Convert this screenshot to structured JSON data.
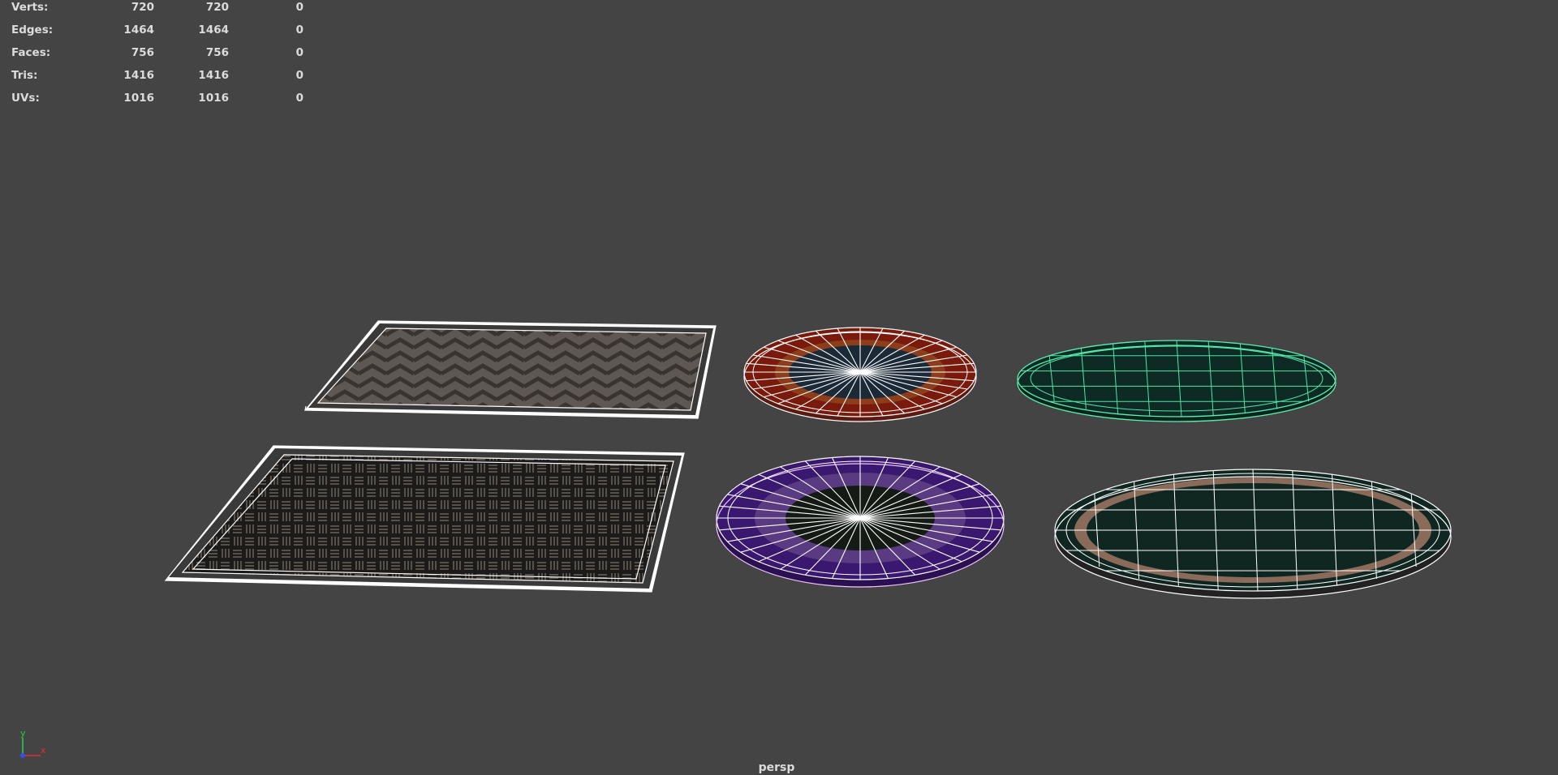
{
  "hud": {
    "rows": [
      {
        "label": "Verts:",
        "v1": "720",
        "v2": "720",
        "v3": "0"
      },
      {
        "label": "Edges:",
        "v1": "1464",
        "v2": "1464",
        "v3": "0"
      },
      {
        "label": "Faces:",
        "v1": "756",
        "v2": "756",
        "v3": "0"
      },
      {
        "label": "Tris:",
        "v1": "1416",
        "v2": "1416",
        "v3": "0"
      },
      {
        "label": "UVs:",
        "v1": "1016",
        "v2": "1016",
        "v3": "0"
      }
    ]
  },
  "viewport": {
    "camera": "persp",
    "background": "#444444",
    "axis": {
      "y": "y",
      "x": "x"
    },
    "objects": [
      {
        "id": "rug-rect-chevron",
        "shape": "rectangular rug",
        "pattern": "chevron",
        "color": "#6b625b"
      },
      {
        "id": "rug-round-red",
        "shape": "round rug",
        "pattern": "rings",
        "color": "#7a1a0c"
      },
      {
        "id": "rug-oval-green",
        "shape": "oval rug",
        "pattern": "grid",
        "color": "#0e2a24",
        "selected": true
      },
      {
        "id": "rug-rect-basket",
        "shape": "rectangular rug",
        "pattern": "basketweave",
        "color": "#2a2725"
      },
      {
        "id": "rug-round-purple",
        "shape": "round rug",
        "pattern": "rings",
        "color": "#3a1870"
      },
      {
        "id": "rug-oval-brown",
        "shape": "oval rug",
        "pattern": "border",
        "color": "#8a6a58"
      }
    ],
    "colors": {
      "wire": "#ffffff",
      "selected_wire": "#66ffaa",
      "hud_text": "#dcdcdc"
    }
  }
}
